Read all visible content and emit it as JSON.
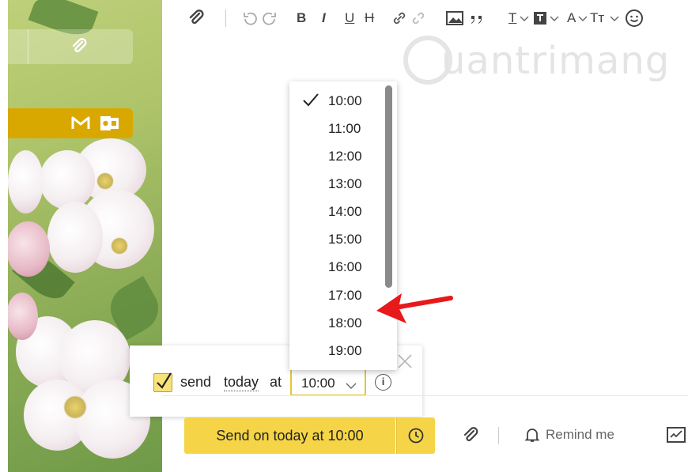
{
  "toolbar": {
    "items": [
      "attach-icon",
      "undo-icon",
      "redo-icon",
      "bold",
      "italic",
      "underline",
      "strikethrough",
      "link-icon",
      "unlink-icon",
      "image-icon",
      "quote-icon",
      "text-format",
      "text-color",
      "font-size",
      "text-case",
      "emoji-icon"
    ],
    "bold": "B",
    "italic": "I",
    "underline": "U",
    "strike": "H",
    "text_format": "T",
    "font_color": "A",
    "text_case": "Tт"
  },
  "watermark": {
    "text": "uantrimang"
  },
  "schedule": {
    "checked": true,
    "prefix": "send",
    "today": "today",
    "at": "at",
    "selected_time": "10:00"
  },
  "dropdown": {
    "options": [
      "10:00",
      "11:00",
      "12:00",
      "13:00",
      "14:00",
      "15:00",
      "16:00",
      "17:00",
      "18:00",
      "19:00"
    ],
    "selected_index": 0
  },
  "bottom": {
    "send_label": "Send on today at 10:00",
    "remind_label": "Remind me"
  },
  "colors": {
    "accent": "#f5d547",
    "sidebar_gold": "#d9a800",
    "arrow": "#e8191b"
  }
}
